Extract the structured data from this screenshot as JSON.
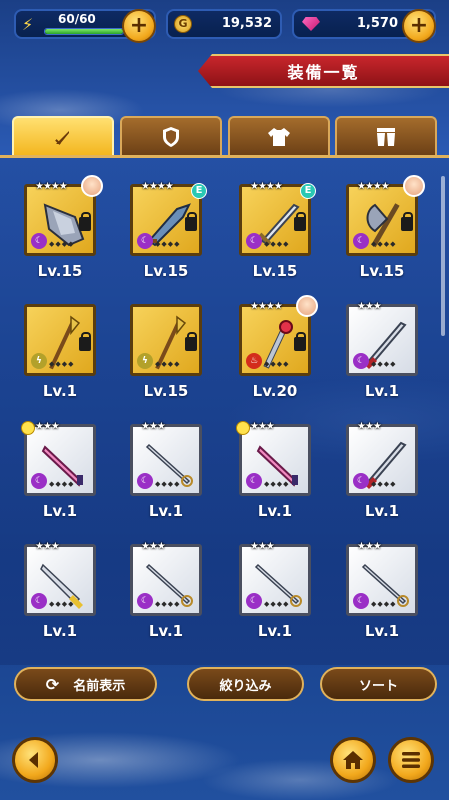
{
  "status": {
    "stamina": {
      "label": "60/60",
      "fill": 1.0
    },
    "gold": "19,532",
    "gems": "1,570"
  },
  "title": "装備一覧",
  "tabs": [
    {
      "name": "weapon",
      "icon": "sword-icon",
      "active": true
    },
    {
      "name": "shield",
      "icon": "shield-icon",
      "active": false
    },
    {
      "name": "armor",
      "icon": "shirt-icon",
      "active": false
    },
    {
      "name": "pants",
      "icon": "pants-icon",
      "active": false
    }
  ],
  "items": [
    {
      "level": "Lv.15",
      "frame": "gold",
      "stars": "★★★★",
      "element": "dark",
      "badge": "avatar",
      "locked": true,
      "weapon": "gauntlet"
    },
    {
      "level": "Lv.15",
      "frame": "gold",
      "stars": "★★★★",
      "element": "dark",
      "badge": "E",
      "locked": true,
      "weapon": "blade"
    },
    {
      "level": "Lv.15",
      "frame": "gold",
      "stars": "★★★★",
      "element": "dark",
      "badge": "E",
      "locked": true,
      "weapon": "sword"
    },
    {
      "level": "Lv.15",
      "frame": "gold",
      "stars": "★★★★",
      "element": "dark",
      "badge": "avatar",
      "locked": true,
      "weapon": "axe"
    },
    {
      "level": "Lv.1",
      "frame": "gold",
      "stars": "",
      "element": "wind",
      "badge": "",
      "locked": true,
      "weapon": "spear"
    },
    {
      "level": "Lv.15",
      "frame": "gold",
      "stars": "",
      "element": "wind",
      "badge": "",
      "locked": true,
      "weapon": "spear"
    },
    {
      "level": "Lv.20",
      "frame": "gold",
      "stars": "★★★★",
      "element": "fire",
      "badge": "avatar",
      "locked": true,
      "weapon": "wand"
    },
    {
      "level": "Lv.1",
      "frame": "white",
      "stars": "★★★",
      "element": "dark",
      "badge": "",
      "locked": false,
      "weapon": "redsword"
    },
    {
      "level": "Lv.1",
      "frame": "white",
      "stars": "★★★",
      "element": "dark",
      "badge": "mark",
      "locked": false,
      "weapon": "pinksword"
    },
    {
      "level": "Lv.1",
      "frame": "white",
      "stars": "★★★",
      "element": "dark",
      "badge": "",
      "locked": false,
      "weapon": "rapier"
    },
    {
      "level": "Lv.1",
      "frame": "white",
      "stars": "★★★",
      "element": "dark",
      "badge": "mark",
      "locked": false,
      "weapon": "pinksword"
    },
    {
      "level": "Lv.1",
      "frame": "white",
      "stars": "★★★",
      "element": "dark",
      "badge": "",
      "locked": false,
      "weapon": "redsword"
    },
    {
      "level": "Lv.1",
      "frame": "white",
      "stars": "★★★",
      "element": "dark",
      "badge": "",
      "locked": false,
      "weapon": "goldsword"
    },
    {
      "level": "Lv.1",
      "frame": "white",
      "stars": "★★★",
      "element": "dark",
      "badge": "",
      "locked": false,
      "weapon": "rapier"
    },
    {
      "level": "Lv.1",
      "frame": "white",
      "stars": "★★★",
      "element": "dark",
      "badge": "",
      "locked": false,
      "weapon": "rapier"
    },
    {
      "level": "Lv.1",
      "frame": "white",
      "stars": "★★★",
      "element": "dark",
      "badge": "",
      "locked": false,
      "weapon": "rapier"
    }
  ],
  "buttons": {
    "name_display": "名前表示",
    "filter": "絞り込み",
    "sort": "ソート"
  },
  "nav": {
    "back": "back-icon",
    "home": "home-icon",
    "menu": "menu-icon"
  }
}
